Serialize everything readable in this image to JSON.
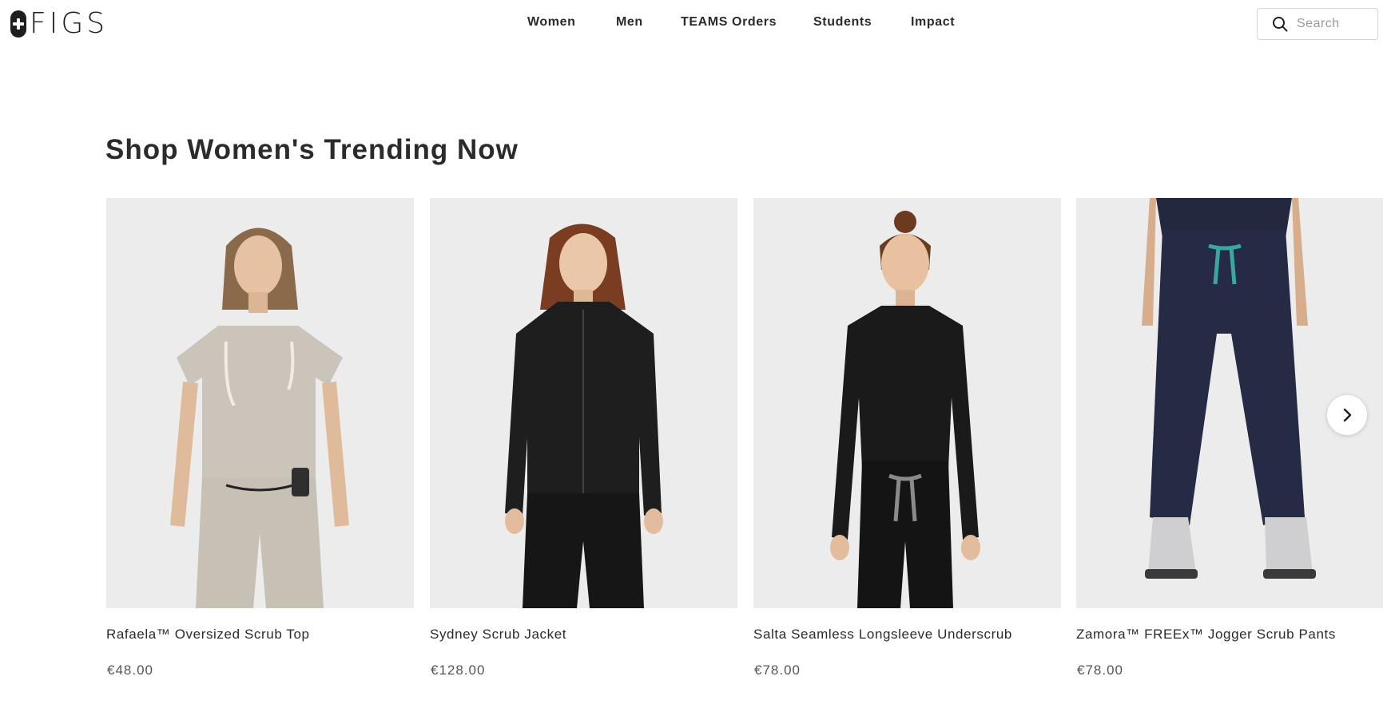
{
  "brand": {
    "logo_text": "FIGS"
  },
  "nav": {
    "items": [
      "Women",
      "Men",
      "TEAMS Orders",
      "Students",
      "Impact"
    ]
  },
  "search": {
    "placeholder": "Search"
  },
  "section": {
    "title": "Shop Women's Trending Now"
  },
  "products": [
    {
      "name": "Rafaela™ Oversized Scrub Top",
      "price": "€48.00"
    },
    {
      "name": "Sydney Scrub Jacket",
      "price": "€128.00"
    },
    {
      "name": "Salta Seamless Longsleeve Underscrub",
      "price": "€78.00"
    },
    {
      "name": "Zamora™ FREEx™ Jogger Scrub Pants",
      "price": "€78.00"
    }
  ],
  "icons": {
    "search": "search-icon",
    "next": "chevron-right-icon"
  },
  "colors": {
    "text": "#2b2b2b",
    "image_bg": "#ececec",
    "logo": "#1e1e1e"
  }
}
